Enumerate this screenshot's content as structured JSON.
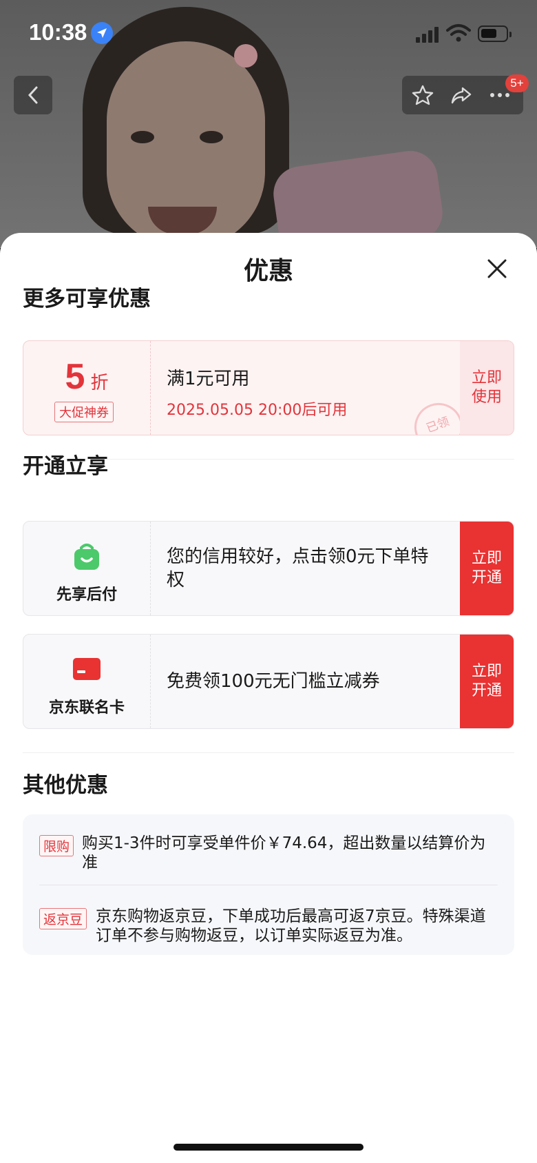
{
  "status_bar": {
    "time": "10:38"
  },
  "nav": {
    "cart_badge": "5+"
  },
  "sheet": {
    "title": "优惠",
    "more_offers": {
      "title": "更多可享优惠",
      "coupon": {
        "discount_value": "5",
        "discount_unit": "折",
        "tag": "大促神券",
        "condition": "满1元可用",
        "available_time": "2025.05.05 20:00后可用",
        "action_label": "立即使用",
        "stamp": "已领"
      }
    },
    "activate": {
      "title": "开通立享",
      "cards": [
        {
          "label": "先享后付",
          "text": "您的信用较好，点击领0元下单特权",
          "action_label": "立即开通",
          "icon": "shopping-bag-icon"
        },
        {
          "label": "京东联名卡",
          "text": "免费领100元无门槛立减券",
          "action_label": "立即开通",
          "icon": "credit-card-icon"
        }
      ]
    },
    "other_offers": {
      "title": "其他优惠",
      "items": [
        {
          "tag": "限购",
          "text": "购买1-3件时可享受单件价￥74.64，超出数量以结算价为准"
        },
        {
          "tag": "返京豆",
          "text": "京东购物返京豆，下单成功后最高可返7京豆。特殊渠道订单不参与购物返豆，以订单实际返豆为准。"
        }
      ]
    }
  },
  "colors": {
    "accent": "#e93232",
    "coupon_bg": "#fdf3f3",
    "card_bg": "#f8f8fa",
    "bag_green": "#4cc96b"
  }
}
